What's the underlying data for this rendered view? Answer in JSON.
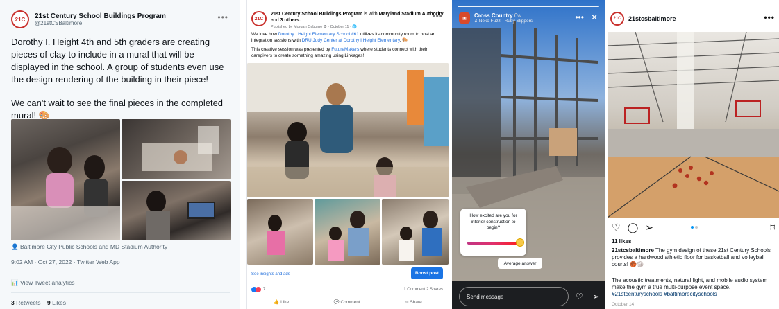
{
  "twitter": {
    "name": "21st Century School Buildings Program",
    "handle": "@21stCSBaltimore",
    "logo_text": "21C",
    "text_p1": "Dorothy I. Height 4th and 5th graders are creating pieces of clay to include in a mural that will be displayed in the school. A group of students even use the design rendering of the building in their piece!",
    "text_p2": "We can't wait to see the final pieces in the completed mural! 🎨",
    "location": "Baltimore City Public Schools and MD Stadium Authority",
    "timestamp": "9:02 AM · Oct 27, 2022 · Twitter Web App",
    "analytics": "View Tweet analytics",
    "retweets_count": "3",
    "retweets_label": "Retweets",
    "likes_count": "9",
    "likes_label": "Likes"
  },
  "facebook": {
    "page_name": "21st Century School Buildings Program",
    "with_text": "is with",
    "partner": "Maryland Stadium Authority",
    "and_text": "and",
    "others": "3 others.",
    "published_by": "Published by Morgan Osborne",
    "date": "October 11",
    "body_p1_a": "We love how",
    "body_p1_link1": "Dorothy I Height Elementary School #61",
    "body_p1_b": "utilizes its community room to host art integration sessions with",
    "body_p1_link2": "DRU Judy Center at Dorothy I Height Elementary",
    "body_p1_c": ". 🎨",
    "body_p2_a": "This creative session was presented by",
    "body_p2_link": "FutureMakers",
    "body_p2_b": "where students connect with their caregivers to create something amazing using Linkages!",
    "insights": "See insights and ads",
    "boost": "Boost post",
    "reactions_count": "7",
    "comments_shares": "1 Comment 2 Shares",
    "like": "Like",
    "comment": "Comment",
    "share": "Share"
  },
  "story": {
    "account": "Cross Country",
    "age": "6w",
    "music": "Neko Fuzz · Ruby Slippers",
    "poll_question": "How excited are you for interior construction to begin?",
    "answer_label": "Average answer",
    "send_placeholder": "Send message"
  },
  "instagram": {
    "username": "21stcsbaltimore",
    "likes": "11 likes",
    "caption_user": "21stcsbaltimore",
    "caption": "The gym design of these 21st Century Schools provides a hardwood athletic floor for basketball and volleyball courts! 🏀🏐",
    "caption2": "The acoustic treatments, natural light, and mobile audio system make the gym a true multi-purpose event space.",
    "hashtags": "#21stcenturyschools #baltimorecityschools",
    "date": "October 14"
  },
  "colors": {
    "brand_red": "#c9302c",
    "fb_blue": "#1b74e4",
    "ig_blue": "#0095f6"
  }
}
